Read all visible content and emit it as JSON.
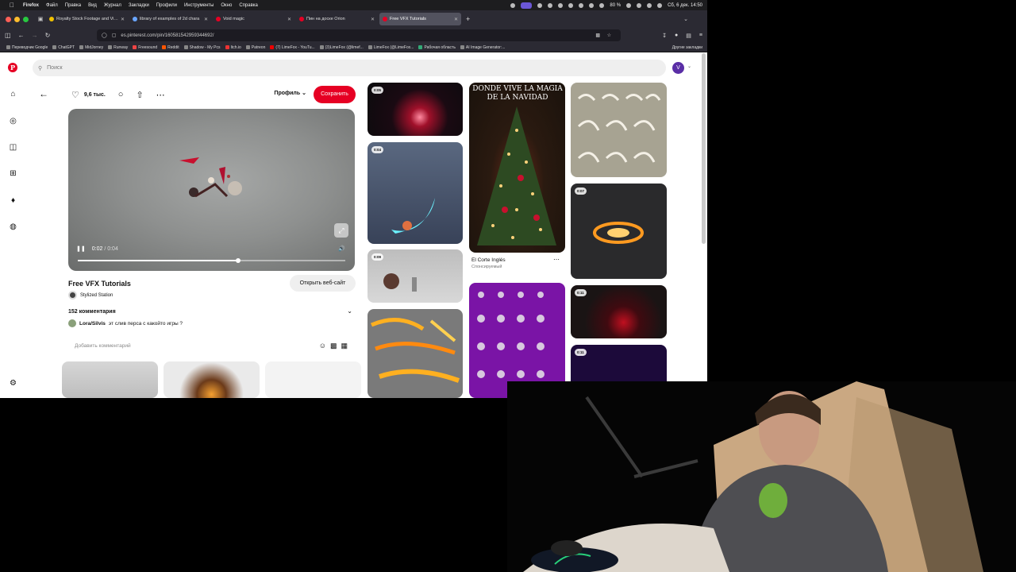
{
  "menubar": {
    "app": "Firefox",
    "items": [
      "Файл",
      "Правка",
      "Вид",
      "Журнал",
      "Закладки",
      "Профили",
      "Инструменты",
      "Окно",
      "Справка"
    ],
    "battery": "80 %",
    "datetime": "Сб, 6 дек.  14:50"
  },
  "tabs": [
    {
      "title": "Royalty Stock Footage and Vide",
      "color": "#f2c200"
    },
    {
      "title": "library of examples of 2d chara",
      "color": "#6aa6ff"
    },
    {
      "title": "Void magic",
      "color": "#e60023"
    },
    {
      "title": "Пин на доске Orion",
      "color": "#e60023"
    },
    {
      "title": "Free VFX Tutorials",
      "color": "#e60023",
      "active": true
    }
  ],
  "address": {
    "host": "es.pinterest.com",
    "path": "/pin/16058154295934469 2/",
    "display": "es.pinterest.com/pin/160581542959344692/"
  },
  "bookmarks": [
    "Переводчик Google",
    "ChatGPT",
    "MidJorney",
    "Runway",
    "Freesound",
    "Reddit",
    "Shadow - My Pcs",
    "Itch.io",
    "Patreon",
    "(7) LimeFox - YouTu...",
    "(3)LimeFox (@limef...",
    "LimeFox (@LimeFox...",
    "Рабочая область",
    "AI Image Generator:..."
  ],
  "bookmarks_other": "Другие закладки",
  "search": {
    "placeholder": "Поиск"
  },
  "user": {
    "initial": "V"
  },
  "pin": {
    "likes": "9,6 тыс.",
    "profile_label": "Профиль",
    "save_label": "Сохранить",
    "time_current": "0:02",
    "time_sep": "/",
    "time_total": "0:04",
    "progress": 0.6,
    "title": "Free VFX Tutorials",
    "open_site": "Открыть веб-сайт",
    "creator": "Stylized Station",
    "comments_count": "152 комментария",
    "comment_user": "Lora/Silvis",
    "comment_text": "эт слив перса с какойто игры ?",
    "add_comment_placeholder": "Добавить комментарий"
  },
  "grid": {
    "badges": [
      "0:05",
      "0:04",
      "0:09",
      "0:07",
      "0:11",
      "0:11"
    ],
    "xmas_text": "DONDE VIVE LA MAGIA DE LA NAVIDAD",
    "sponsor_name": "El Corte Inglés",
    "sponsor_label": "Спонсируемый"
  },
  "colors": {
    "pinterest_red": "#e60023",
    "avatar": "#5a2ea6",
    "browser_chrome": "#2b2a33"
  }
}
